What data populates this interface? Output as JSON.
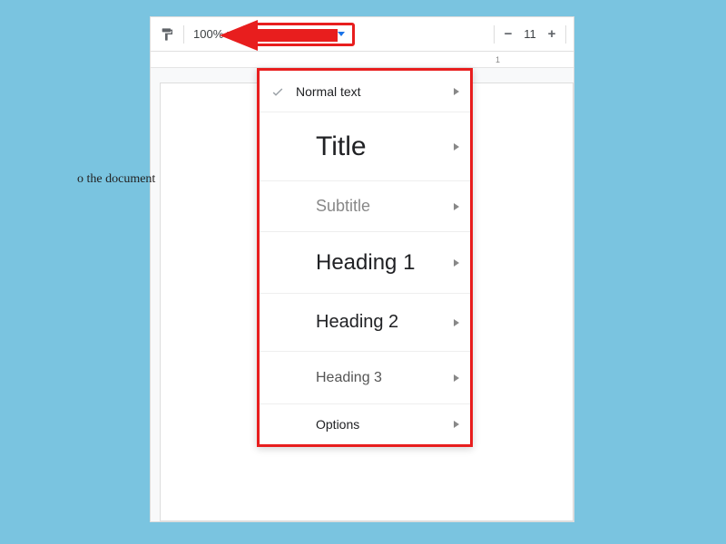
{
  "toolbar": {
    "zoom_level": "100%",
    "style_selector_label": "Normal text",
    "font_size": "11",
    "minus": "−",
    "plus": "+"
  },
  "ruler": {
    "tick1": "1"
  },
  "document": {
    "visible_text": "o the document"
  },
  "dropdown": {
    "items": [
      {
        "id": "normal",
        "label": "Normal text",
        "checked": true
      },
      {
        "id": "title",
        "label": "Title",
        "checked": false
      },
      {
        "id": "subtitle",
        "label": "Subtitle",
        "checked": false
      },
      {
        "id": "heading1",
        "label": "Heading 1",
        "checked": false
      },
      {
        "id": "heading2",
        "label": "Heading 2",
        "checked": false
      },
      {
        "id": "heading3",
        "label": "Heading 3",
        "checked": false
      },
      {
        "id": "options",
        "label": "Options",
        "checked": false
      }
    ]
  },
  "annotation": {
    "highlight_color": "#e81e1e"
  }
}
